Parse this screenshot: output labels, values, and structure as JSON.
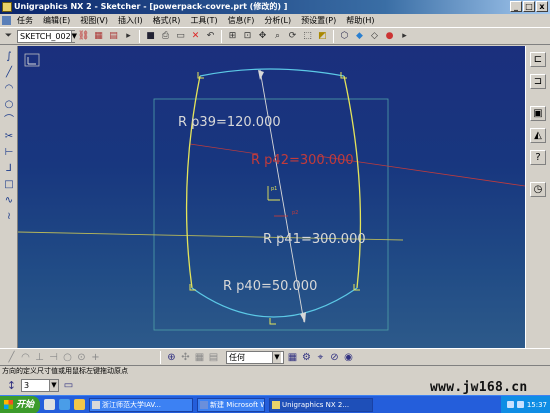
{
  "window": {
    "title": "Unigraphics NX 2 - Sketcher - [powerpack-covre.prt  (修改的) ]",
    "buttons": [
      "_",
      "□",
      "x"
    ]
  },
  "menubar": {
    "items": [
      "任务",
      "编辑(E)",
      "视图(V)",
      "插入(I)",
      "格式(R)",
      "工具(T)",
      "信息(F)",
      "分析(L)",
      "预设置(P)",
      "帮助(H)"
    ]
  },
  "toolbar": {
    "sketch_select": "SKETCH_002"
  },
  "sketch": {
    "dim_top": "R p39=120.000",
    "dim_right": "R p42=300.000",
    "dim_middle": "R p41=300.000",
    "dim_bottom": "R p40=50.000",
    "small_label_a": "p1",
    "small_label_b": "p2"
  },
  "bottom_toolbar": {
    "filter_select": "任何"
  },
  "status": {
    "prompt": "方向的定义尺寸值或用鼠标左键拖动原点"
  },
  "sub_toolbar": {
    "count_value": "3"
  },
  "taskbar": {
    "start_label": "开始",
    "tasks": [
      "浙江师范大学IAV...",
      "新建 Microsoft W...",
      "Unigraphics NX 2..."
    ],
    "tray_time": "15:37"
  },
  "watermark": "www.jw168.cn",
  "colors": {
    "canvas_top": "#1b2f7d",
    "sketch_curve": "#e4e45a",
    "dimension_text": "#d8d8d8",
    "constraint_red": "#d33a3a",
    "arc_cyan": "#5cc9e6"
  }
}
